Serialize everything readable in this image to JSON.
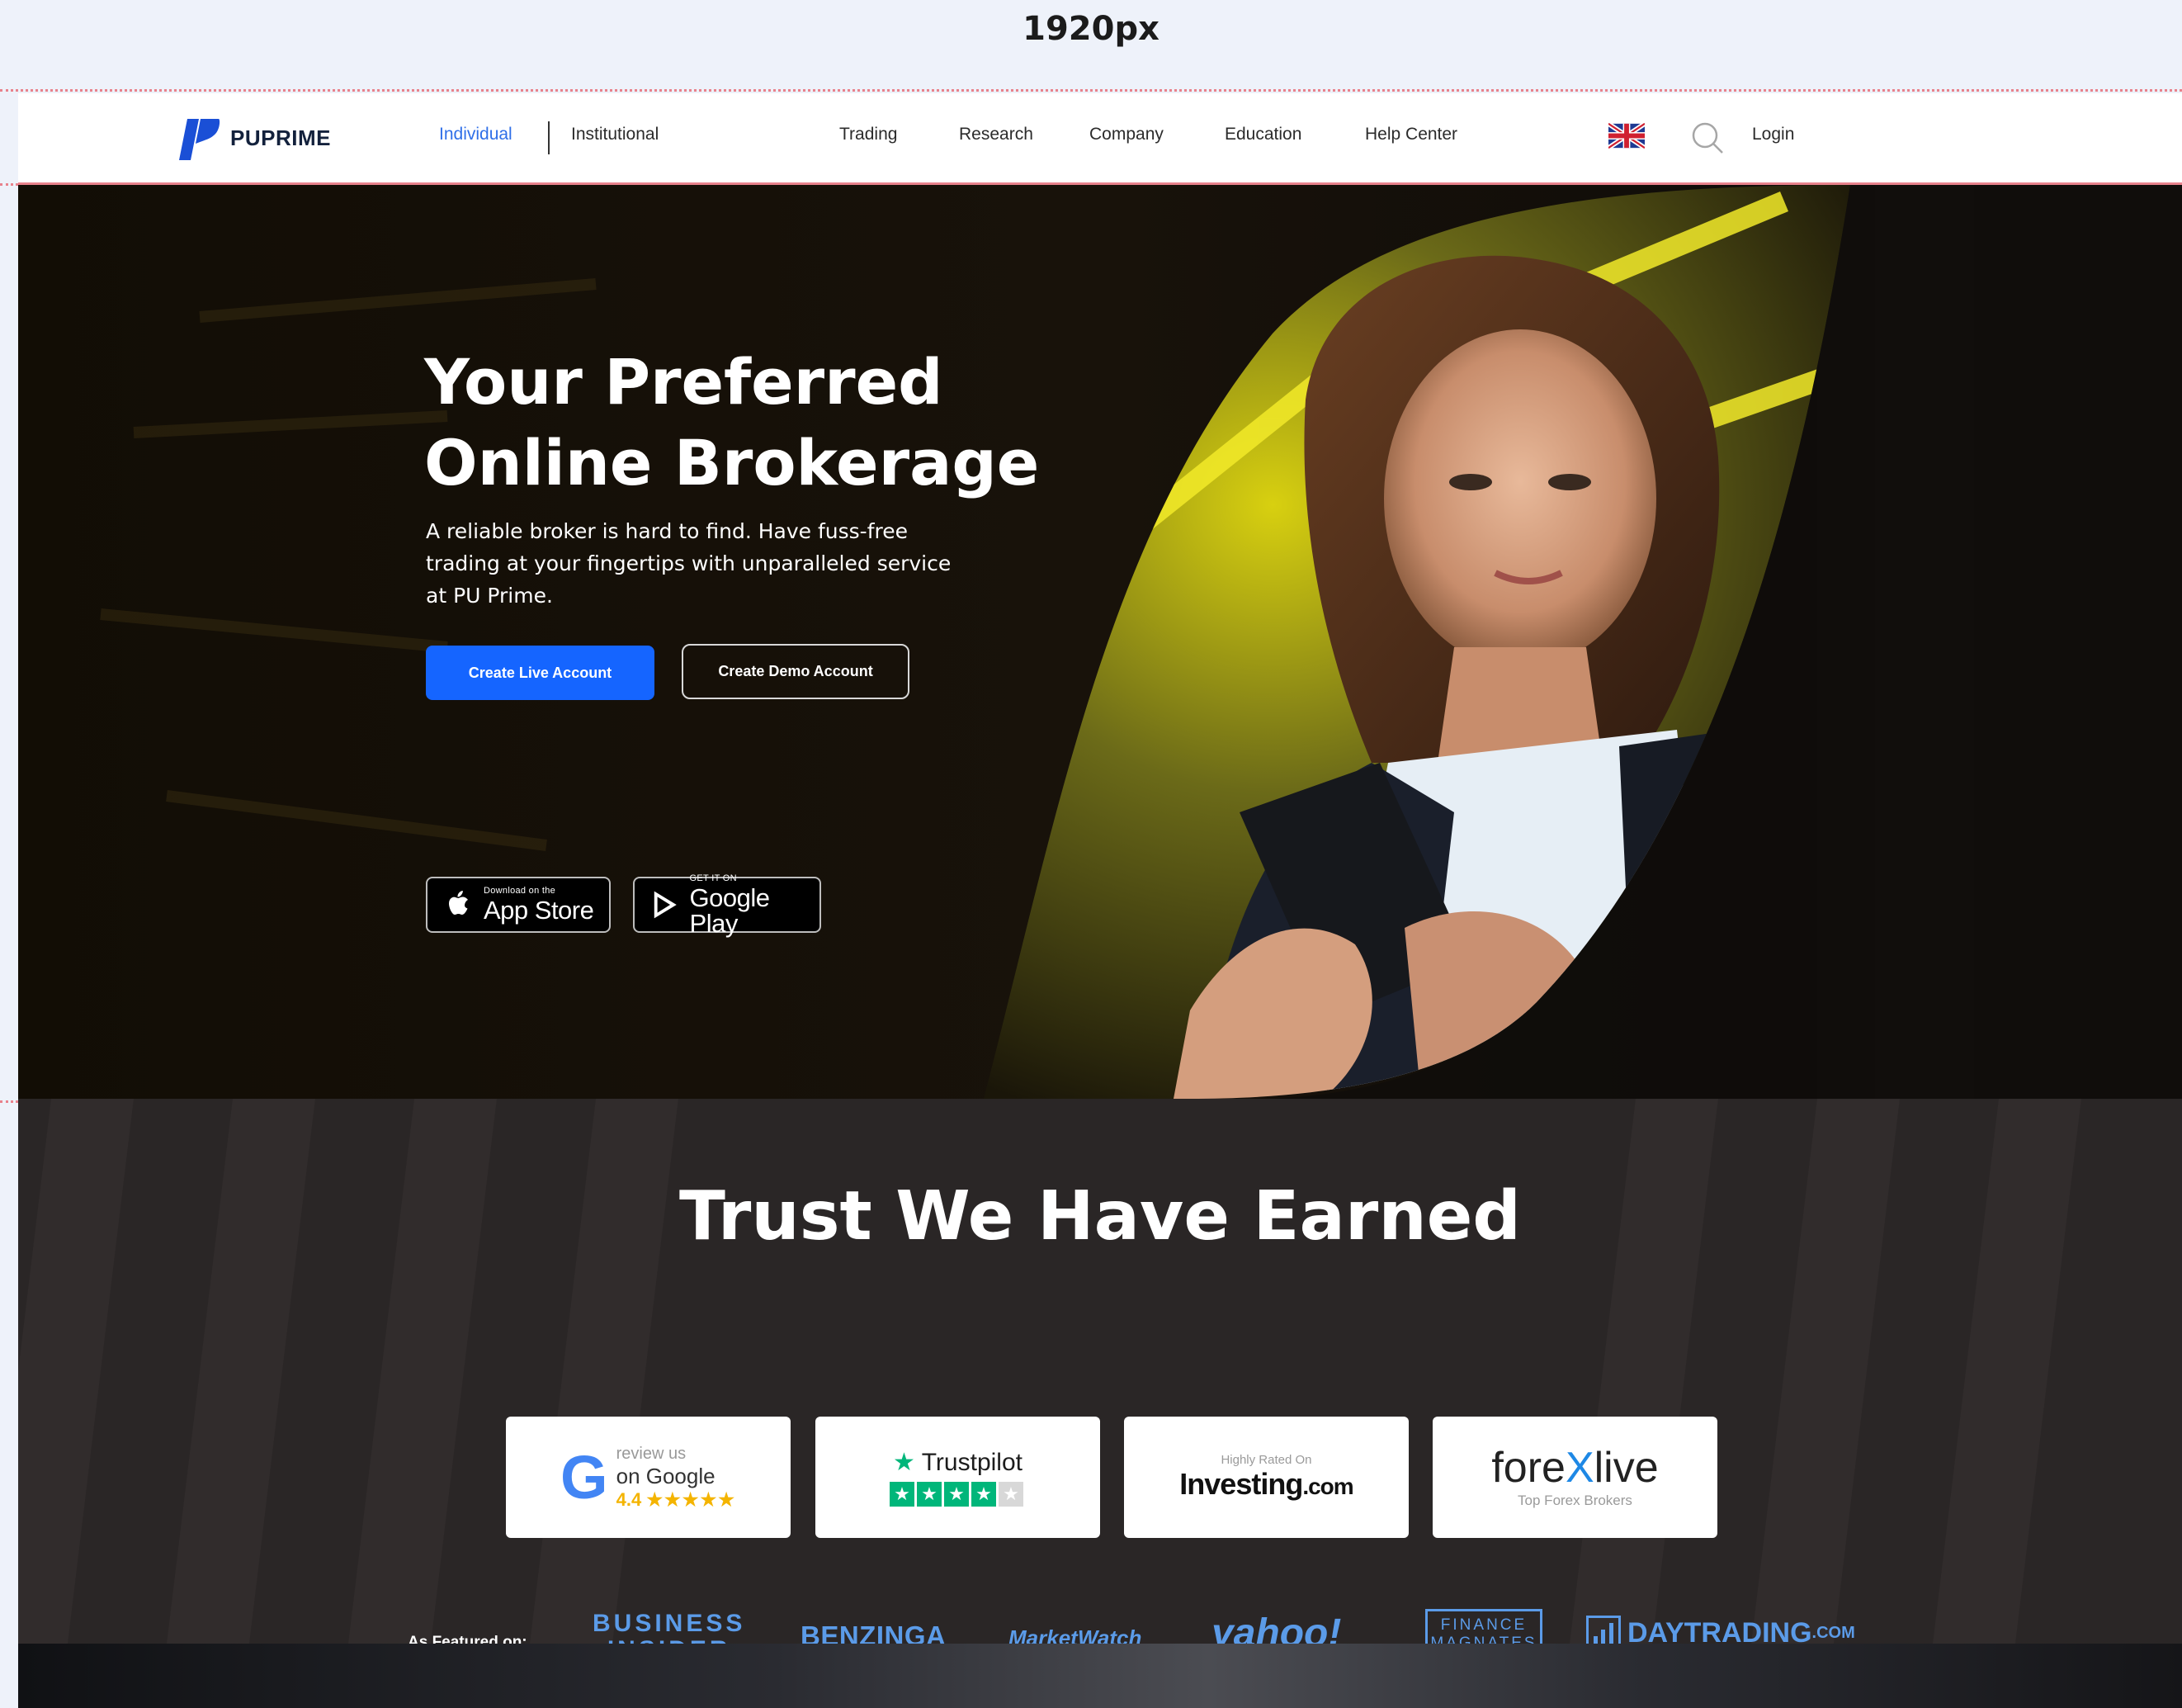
{
  "ruler": {
    "label": "1920px"
  },
  "header": {
    "logo_text": "PUPRIME",
    "segments": {
      "individual": "Individual",
      "institutional": "Institutional"
    },
    "nav": {
      "trading": "Trading",
      "research": "Research",
      "company": "Company",
      "education": "Education",
      "help_center": "Help Center"
    },
    "login": "Login",
    "language_flag": "uk-flag-icon"
  },
  "hero": {
    "title_line1": "Your Preferred",
    "title_line2": "Online Brokerage",
    "subtitle": "A reliable broker is hard to find. Have fuss-free trading at your fingertips with unparalleled service at PU Prime.",
    "live_button": "Create Live Account",
    "demo_button": "Create Demo Account",
    "app_store": {
      "small": "Download on the",
      "big": "App Store"
    },
    "google_play": {
      "small": "GET IT ON",
      "big": "Google Play"
    }
  },
  "trust": {
    "title": "Trust We Have Earned",
    "cards": {
      "google": {
        "letter": "G",
        "review": "review us",
        "on": "on Google",
        "rating": "4.4",
        "stars": "★★★★★"
      },
      "trustpilot": {
        "star": "★",
        "name": "Trustpilot",
        "star_glyph": "★",
        "rating_stars": 4
      },
      "investing": {
        "small": "Highly Rated On",
        "name": "Investing",
        "com": ".com"
      },
      "forexlive": {
        "pre": "fore",
        "x": "X",
        "post": "live",
        "small": "Top Forex Brokers"
      }
    },
    "featured_label": "As Featured on:",
    "press": {
      "business_insider_line1": "BUSINESS",
      "business_insider_line2": "INSIDER",
      "benzinga": "BENZINGA",
      "marketwatch": "MarketWatch",
      "yahoo": "yahoo!",
      "finance_magnates_line1": "FINANCE",
      "finance_magnates_line2": "MAGNATES",
      "daytrading": "DAYTRADING",
      "daytrading_com": ".COM"
    }
  },
  "colors": {
    "accent_blue": "#1565ff",
    "active_nav": "#2f6fe8",
    "guide_pink": "#e8828c",
    "press_blue": "#5b9be8",
    "trustpilot_green": "#00b67a"
  }
}
